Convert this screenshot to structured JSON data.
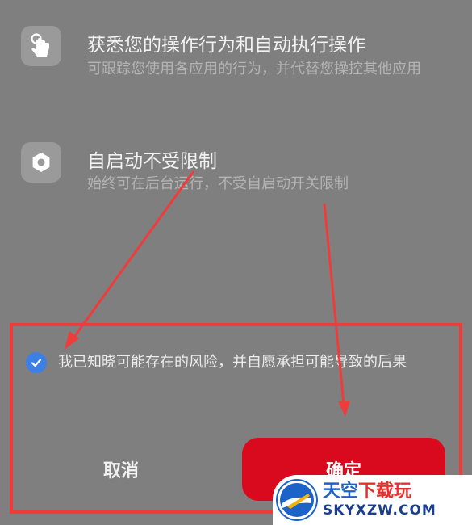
{
  "permissions": [
    {
      "icon": "touch-gesture-icon",
      "title": "获悉您的操作行为和自动执行操作",
      "description": "可跟踪您使用各应用的行为，并代替您操控其他应用"
    },
    {
      "icon": "hexagon-nut-icon",
      "title": "自启动不受限制",
      "description": "始终可在后台运行，不受自启动开关限制"
    }
  ],
  "consent": {
    "checked": true,
    "text": "我已知晓可能存在的风险，并自愿承担可能导致的后果"
  },
  "buttons": {
    "cancel": "取消",
    "confirm": "确定"
  },
  "colors": {
    "accent_red": "#d90a1e",
    "checkbox_blue": "#3c80e6",
    "annotation_red": "#f03b3b"
  },
  "watermark": {
    "name_part1": "天空",
    "name_part2": "下载玩",
    "domain": "SKYXZW.COM"
  }
}
